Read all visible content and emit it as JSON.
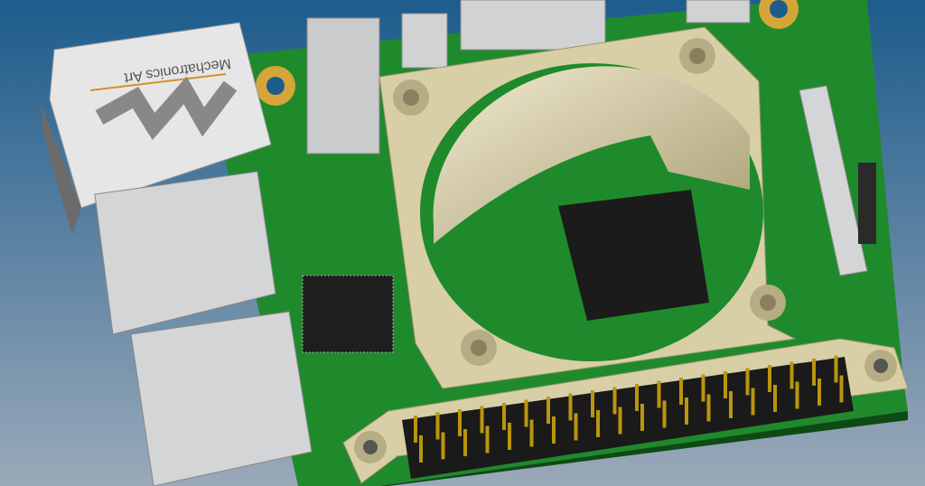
{
  "scene": {
    "logo_text": "Mechatronics Art",
    "colors": {
      "background_top": "#1d5c8c",
      "background_bottom": "#9aa9b9",
      "board": "#1f8a2b",
      "shroud": "#d8cfa6",
      "chip": "#1b1b1b",
      "metal": "#c9cbcd",
      "gold": "#b8960e"
    }
  }
}
